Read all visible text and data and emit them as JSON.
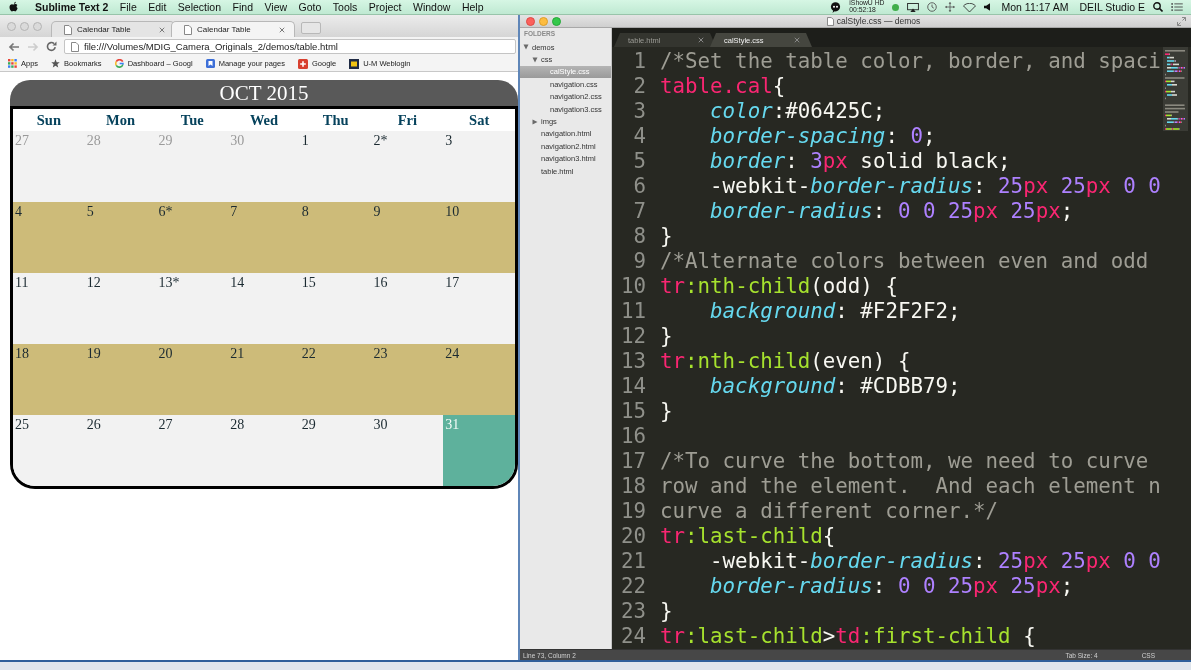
{
  "menu_bar": {
    "app_name": "Sublime Text 2",
    "menus": [
      "File",
      "Edit",
      "Selection",
      "Find",
      "View",
      "Goto",
      "Tools",
      "Project",
      "Window",
      "Help"
    ],
    "recorder": {
      "name": "iShowU HD",
      "time": "00:52:18"
    },
    "clock": "Mon 11:17 AM",
    "user": "DEIL Studio E"
  },
  "browser": {
    "tabs": [
      {
        "title": "Calendar Table",
        "selected": false
      },
      {
        "title": "Calendar Table",
        "selected": true
      }
    ],
    "forward_disabled": true,
    "address": "file:///Volumes/MDIG_Camera_Originals_2/demos/table.html",
    "bookmarks": [
      {
        "label": "Apps",
        "kind": "apps"
      },
      {
        "label": "Bookmarks",
        "kind": "star"
      },
      {
        "label": "Dashboard – Googl",
        "kind": "google"
      },
      {
        "label": "Manage your pages",
        "kind": "site"
      },
      {
        "label": "Google",
        "kind": "plus"
      },
      {
        "label": "U-M Weblogin",
        "kind": "block"
      }
    ]
  },
  "calendar": {
    "title": "OCT 2015",
    "weekdays": [
      "Sun",
      "Mon",
      "Tue",
      "Wed",
      "Thu",
      "Fri",
      "Sat"
    ],
    "weeks": [
      [
        {
          "day": "27",
          "muted": true,
          "highlighted": false
        },
        {
          "day": "28",
          "muted": true,
          "highlighted": false
        },
        {
          "day": "29",
          "muted": true,
          "highlighted": false
        },
        {
          "day": "30",
          "muted": true,
          "highlighted": false
        },
        {
          "day": "1",
          "muted": false,
          "highlighted": false
        },
        {
          "day": "2*",
          "muted": false,
          "highlighted": false
        },
        {
          "day": "3",
          "muted": false,
          "highlighted": false
        }
      ],
      [
        {
          "day": "4",
          "muted": false,
          "highlighted": false
        },
        {
          "day": "5",
          "muted": false,
          "highlighted": false
        },
        {
          "day": "6*",
          "muted": false,
          "highlighted": false
        },
        {
          "day": "7",
          "muted": false,
          "highlighted": false
        },
        {
          "day": "8",
          "muted": false,
          "highlighted": false
        },
        {
          "day": "9",
          "muted": false,
          "highlighted": false
        },
        {
          "day": "10",
          "muted": false,
          "highlighted": false
        }
      ],
      [
        {
          "day": "11",
          "muted": false,
          "highlighted": false
        },
        {
          "day": "12",
          "muted": false,
          "highlighted": false
        },
        {
          "day": "13*",
          "muted": false,
          "highlighted": false
        },
        {
          "day": "14",
          "muted": false,
          "highlighted": false
        },
        {
          "day": "15",
          "muted": false,
          "highlighted": false
        },
        {
          "day": "16",
          "muted": false,
          "highlighted": false
        },
        {
          "day": "17",
          "muted": false,
          "highlighted": false
        }
      ],
      [
        {
          "day": "18",
          "muted": false,
          "highlighted": false
        },
        {
          "day": "19",
          "muted": false,
          "highlighted": false
        },
        {
          "day": "20",
          "muted": false,
          "highlighted": false
        },
        {
          "day": "21",
          "muted": false,
          "highlighted": false
        },
        {
          "day": "22",
          "muted": false,
          "highlighted": false
        },
        {
          "day": "23",
          "muted": false,
          "highlighted": false
        },
        {
          "day": "24",
          "muted": false,
          "highlighted": false
        }
      ],
      [
        {
          "day": "25",
          "muted": false,
          "highlighted": false
        },
        {
          "day": "26",
          "muted": false,
          "highlighted": false
        },
        {
          "day": "27",
          "muted": false,
          "highlighted": false
        },
        {
          "day": "28",
          "muted": false,
          "highlighted": false
        },
        {
          "day": "29",
          "muted": false,
          "highlighted": false
        },
        {
          "day": "30",
          "muted": false,
          "highlighted": false
        },
        {
          "day": "31",
          "muted": false,
          "highlighted": true
        }
      ]
    ]
  },
  "editor": {
    "title": "calStyle.css — demos",
    "sidebar": {
      "heading": "FOLDERS",
      "items": [
        {
          "label": "demos",
          "kind": "folder",
          "expanded": true,
          "selected": false,
          "children": [
            {
              "label": "css",
              "kind": "folder",
              "expanded": true,
              "selected": false,
              "children": [
                {
                  "label": "calStyle.css",
                  "kind": "file",
                  "selected": true
                },
                {
                  "label": "navigation.css",
                  "kind": "file",
                  "selected": false
                },
                {
                  "label": "navigation2.css",
                  "kind": "file",
                  "selected": false
                },
                {
                  "label": "navigation3.css",
                  "kind": "file",
                  "selected": false
                }
              ]
            },
            {
              "label": "imgs",
              "kind": "folder",
              "expanded": false,
              "selected": false
            },
            {
              "label": "navigation.html",
              "kind": "file",
              "selected": false
            },
            {
              "label": "navigation2.html",
              "kind": "file",
              "selected": false
            },
            {
              "label": "navigation3.html",
              "kind": "file",
              "selected": false
            },
            {
              "label": "table.html",
              "kind": "file",
              "selected": false
            }
          ]
        }
      ]
    },
    "tabs": [
      {
        "title": "table.html",
        "selected": false
      },
      {
        "title": "calStyle.css",
        "selected": true
      }
    ],
    "lines": [
      {
        "number": "1",
        "tokens": [
          {
            "text": "/*Set the table color, border, and spaci",
            "kind": "comment"
          }
        ]
      },
      {
        "number": "2",
        "tokens": [
          {
            "text": "table.cal",
            "kind": "tag"
          },
          {
            "text": "{",
            "kind": "plain"
          }
        ]
      },
      {
        "number": "3",
        "tokens": [
          {
            "text": "    color",
            "kind": "property"
          },
          {
            "text": ":#06425C;",
            "kind": "plain"
          }
        ]
      },
      {
        "number": "4",
        "tokens": [
          {
            "text": "    border-spacing",
            "kind": "property"
          },
          {
            "text": ": ",
            "kind": "plain"
          },
          {
            "text": "0",
            "kind": "number"
          },
          {
            "text": ";",
            "kind": "plain"
          }
        ]
      },
      {
        "number": "5",
        "tokens": [
          {
            "text": "    border",
            "kind": "property"
          },
          {
            "text": ": ",
            "kind": "plain"
          },
          {
            "text": "3",
            "kind": "number"
          },
          {
            "text": "px",
            "kind": "unit"
          },
          {
            "text": " solid black;",
            "kind": "plain"
          }
        ]
      },
      {
        "number": "6",
        "tokens": [
          {
            "text": "    -webkit-",
            "kind": "plain"
          },
          {
            "text": "border-radius",
            "kind": "property"
          },
          {
            "text": ": ",
            "kind": "plain"
          },
          {
            "text": "25",
            "kind": "number"
          },
          {
            "text": "px",
            "kind": "unit"
          },
          {
            "text": " 25",
            "kind": "number"
          },
          {
            "text": "px",
            "kind": "unit"
          },
          {
            "text": " 0 0",
            "kind": "number"
          }
        ]
      },
      {
        "number": "7",
        "tokens": [
          {
            "text": "    border-radius",
            "kind": "property"
          },
          {
            "text": ": ",
            "kind": "plain"
          },
          {
            "text": "0 0 25",
            "kind": "number"
          },
          {
            "text": "px",
            "kind": "unit"
          },
          {
            "text": " 25",
            "kind": "number"
          },
          {
            "text": "px",
            "kind": "unit"
          },
          {
            "text": ";",
            "kind": "plain"
          }
        ]
      },
      {
        "number": "8",
        "tokens": [
          {
            "text": "}",
            "kind": "plain"
          }
        ]
      },
      {
        "number": "9",
        "tokens": [
          {
            "text": "/*Alternate colors between even and odd",
            "kind": "comment"
          }
        ]
      },
      {
        "number": "10",
        "tokens": [
          {
            "text": "tr",
            "kind": "tag"
          },
          {
            "text": ":nth-child",
            "kind": "pseudo"
          },
          {
            "text": "(odd) {",
            "kind": "plain"
          }
        ]
      },
      {
        "number": "11",
        "tokens": [
          {
            "text": "    background",
            "kind": "property"
          },
          {
            "text": ": #F2F2F2;",
            "kind": "plain"
          }
        ]
      },
      {
        "number": "12",
        "tokens": [
          {
            "text": "}",
            "kind": "plain"
          }
        ]
      },
      {
        "number": "13",
        "tokens": [
          {
            "text": "tr",
            "kind": "tag"
          },
          {
            "text": ":nth-child",
            "kind": "pseudo"
          },
          {
            "text": "(even) {",
            "kind": "plain"
          }
        ]
      },
      {
        "number": "14",
        "tokens": [
          {
            "text": "    background",
            "kind": "property"
          },
          {
            "text": ": #CDBB79;",
            "kind": "plain"
          }
        ]
      },
      {
        "number": "15",
        "tokens": [
          {
            "text": "}",
            "kind": "plain"
          }
        ]
      },
      {
        "number": "16"
      },
      {
        "number": "17",
        "tokens": [
          {
            "text": "/*To curve the bottom, we need to curve",
            "kind": "comment"
          }
        ]
      },
      {
        "number": "18",
        "tokens": [
          {
            "text": "row and the element.  And each element n",
            "kind": "comment"
          }
        ]
      },
      {
        "number": "19",
        "tokens": [
          {
            "text": "curve a different corner.*/",
            "kind": "comment"
          }
        ]
      },
      {
        "number": "20",
        "tokens": [
          {
            "text": "tr",
            "kind": "tag"
          },
          {
            "text": ":last-child",
            "kind": "pseudo"
          },
          {
            "text": "{",
            "kind": "plain"
          }
        ]
      },
      {
        "number": "21",
        "tokens": [
          {
            "text": "    -webkit-",
            "kind": "plain"
          },
          {
            "text": "border-radius",
            "kind": "property"
          },
          {
            "text": ": ",
            "kind": "plain"
          },
          {
            "text": "25",
            "kind": "number"
          },
          {
            "text": "px",
            "kind": "unit"
          },
          {
            "text": " 25",
            "kind": "number"
          },
          {
            "text": "px",
            "kind": "unit"
          },
          {
            "text": " 0 0",
            "kind": "number"
          }
        ]
      },
      {
        "number": "22",
        "tokens": [
          {
            "text": "    border-radius",
            "kind": "property"
          },
          {
            "text": ": ",
            "kind": "plain"
          },
          {
            "text": "0 0 25",
            "kind": "number"
          },
          {
            "text": "px",
            "kind": "unit"
          },
          {
            "text": " 25",
            "kind": "number"
          },
          {
            "text": "px",
            "kind": "unit"
          },
          {
            "text": ";",
            "kind": "plain"
          }
        ]
      },
      {
        "number": "23",
        "tokens": [
          {
            "text": "}",
            "kind": "plain"
          }
        ]
      },
      {
        "number": "24",
        "tokens": [
          {
            "text": "tr",
            "kind": "tag"
          },
          {
            "text": ":last-child",
            "kind": "pseudo"
          },
          {
            "text": ">",
            "kind": "plain"
          },
          {
            "text": "td",
            "kind": "tag"
          },
          {
            "text": ":first-child",
            "kind": "pseudo"
          },
          {
            "text": " {",
            "kind": "plain"
          }
        ]
      }
    ],
    "status_bar": {
      "position": "Line 73, Column 2",
      "tab_size": "Tab Size: 4",
      "syntax": "CSS"
    }
  }
}
